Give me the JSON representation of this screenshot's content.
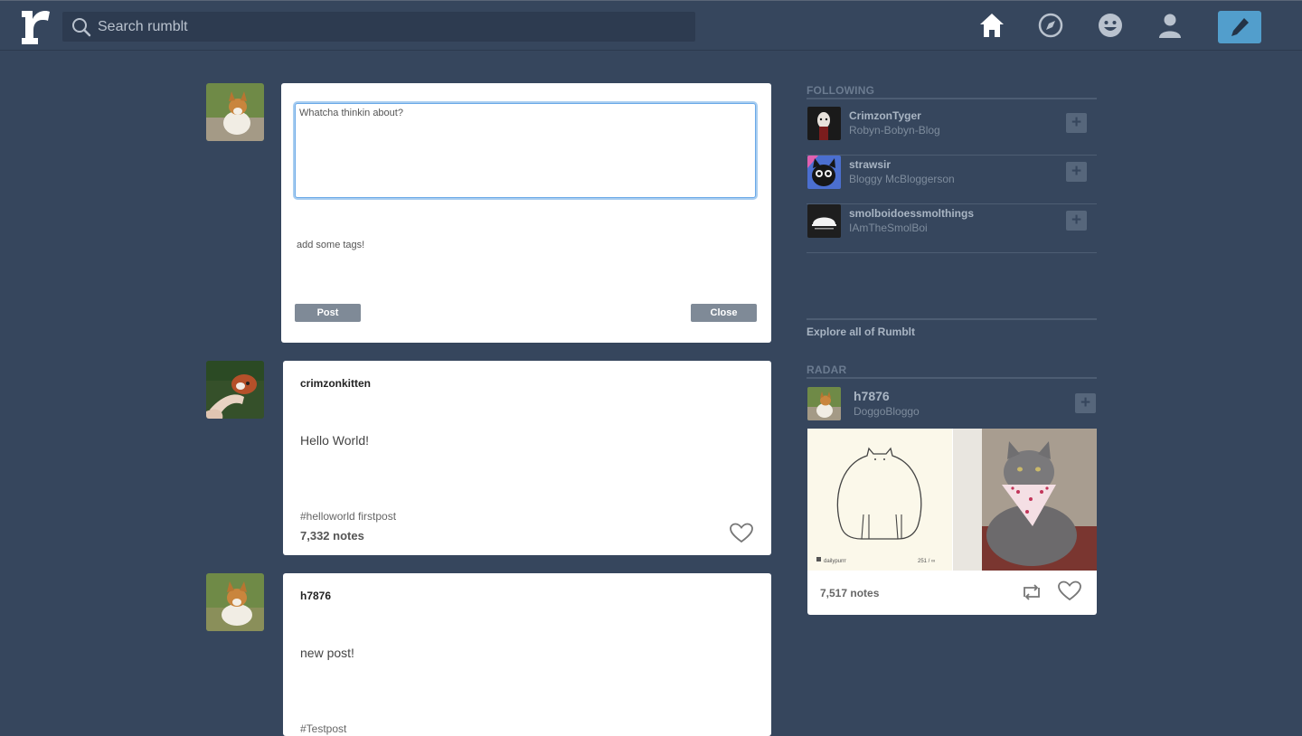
{
  "header": {
    "logo_letter": "r",
    "search_placeholder": "Search rumblt",
    "nav_icons": [
      "home-icon",
      "compass-icon",
      "smiley-icon",
      "user-icon",
      "pencil-icon"
    ]
  },
  "composer": {
    "textarea_placeholder": "Whatcha thinkin about?",
    "tags_placeholder": "add some tags!",
    "post_label": "Post",
    "close_label": "Close"
  },
  "posts": [
    {
      "author": "crimzonkitten",
      "body": "Hello World!",
      "tags": "#helloworld firstpost",
      "notes": "7,332 notes"
    },
    {
      "author": "h7876",
      "body": "new post!",
      "tags": "#Testpost",
      "notes": ""
    }
  ],
  "sidebar": {
    "following_heading": "FOLLOWING",
    "following": [
      {
        "name": "CrimzonTyger",
        "title": "Robyn-Bobyn-Blog"
      },
      {
        "name": "strawsir",
        "title": "Bloggy McBloggerson"
      },
      {
        "name": "smolboidoessmolthings",
        "title": "IAmTheSmolBoi"
      }
    ],
    "explore_label": "Explore all of Rumblt",
    "radar_heading": "RADAR",
    "radar": {
      "name": "h7876",
      "title": "DoggoBloggo",
      "notes": "7,517 notes",
      "image_caption": "dailypurrr",
      "image_counter": "251 / ∞"
    }
  },
  "colors": {
    "background": "#36465d",
    "accent": "#529ecc",
    "button_gray": "#7f8a97"
  }
}
